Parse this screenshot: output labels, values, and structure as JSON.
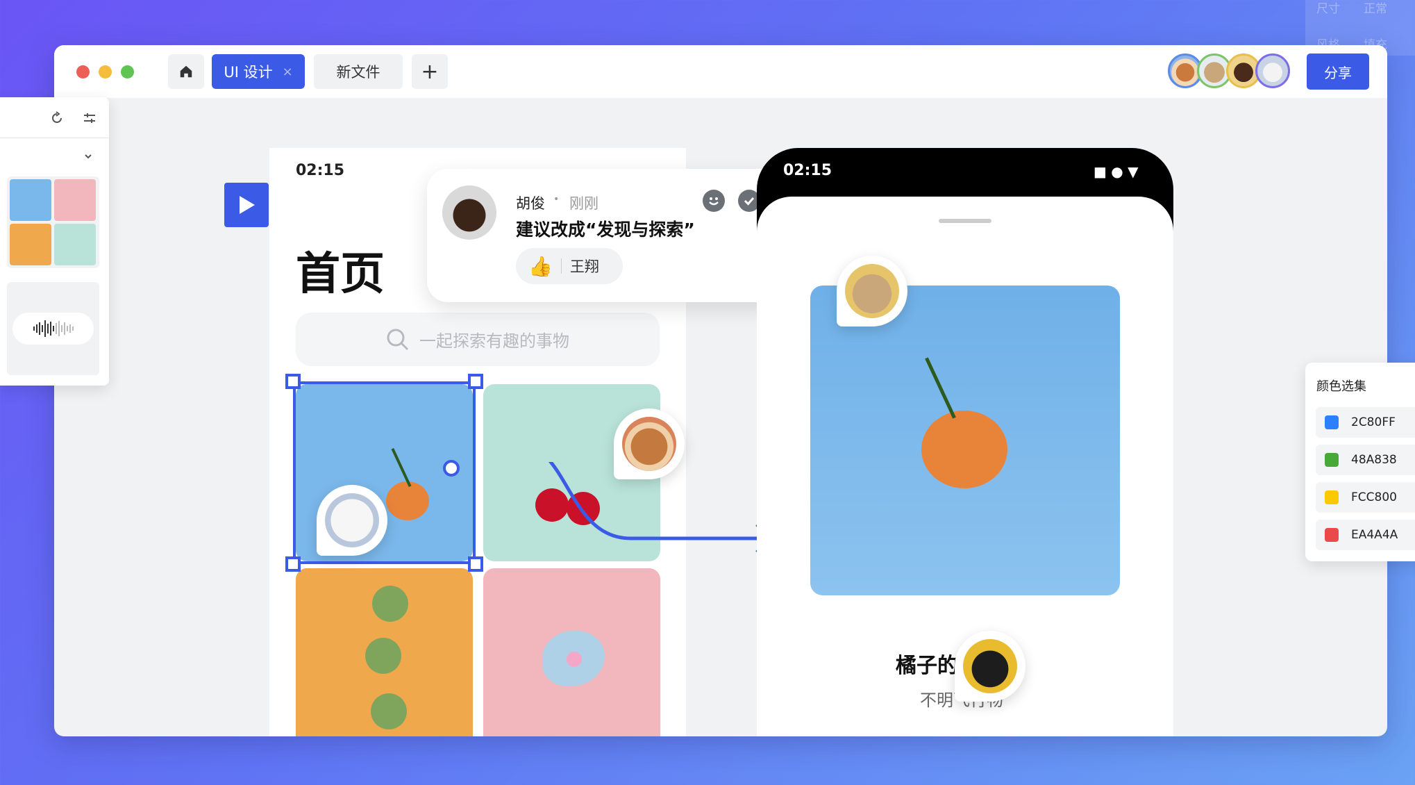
{
  "corner": {
    "size_label": "尺寸",
    "size_value": "正常",
    "style_label": "风格",
    "style_value": "填充"
  },
  "window": {
    "tabs": [
      {
        "label": "UI 设计",
        "close": "×"
      },
      {
        "label": "新文件"
      }
    ],
    "add_tab": "+",
    "share_label": "分享",
    "collaborator_count": 4
  },
  "left_panel": {
    "thumbnails": [
      "orange",
      "lollipop",
      "brussels-sprouts",
      "cherries"
    ]
  },
  "left_phone": {
    "time": "02:15",
    "title": "首页",
    "search_placeholder": "一起探索有趣的事物"
  },
  "comment": {
    "author": "胡俊",
    "separator": "•",
    "time": "刚刚",
    "text": "建议改成“发现与探索”",
    "reaction_user": "王翔",
    "reaction_emoji": "👍"
  },
  "right_phone": {
    "time": "02:15",
    "status_icons": "■ ● ▼",
    "caption_title": "橘子的一天",
    "caption_subtitle": "不明飞行物"
  },
  "color_panel": {
    "title": "颜色选集",
    "colors": [
      {
        "hex": "2C80FF",
        "value": "#2C80FF"
      },
      {
        "hex": "48A838",
        "value": "#48A838"
      },
      {
        "hex": "FCC800",
        "value": "#FCC800"
      },
      {
        "hex": "EA4A4A",
        "value": "#EA4A4A"
      }
    ]
  },
  "theme": {
    "accent": "#3b5be6",
    "tile_blue": "#7ab7ea",
    "tile_mint": "#b9e3d8",
    "tile_orange": "#f0a84d",
    "tile_pink": "#f2b7bd"
  }
}
